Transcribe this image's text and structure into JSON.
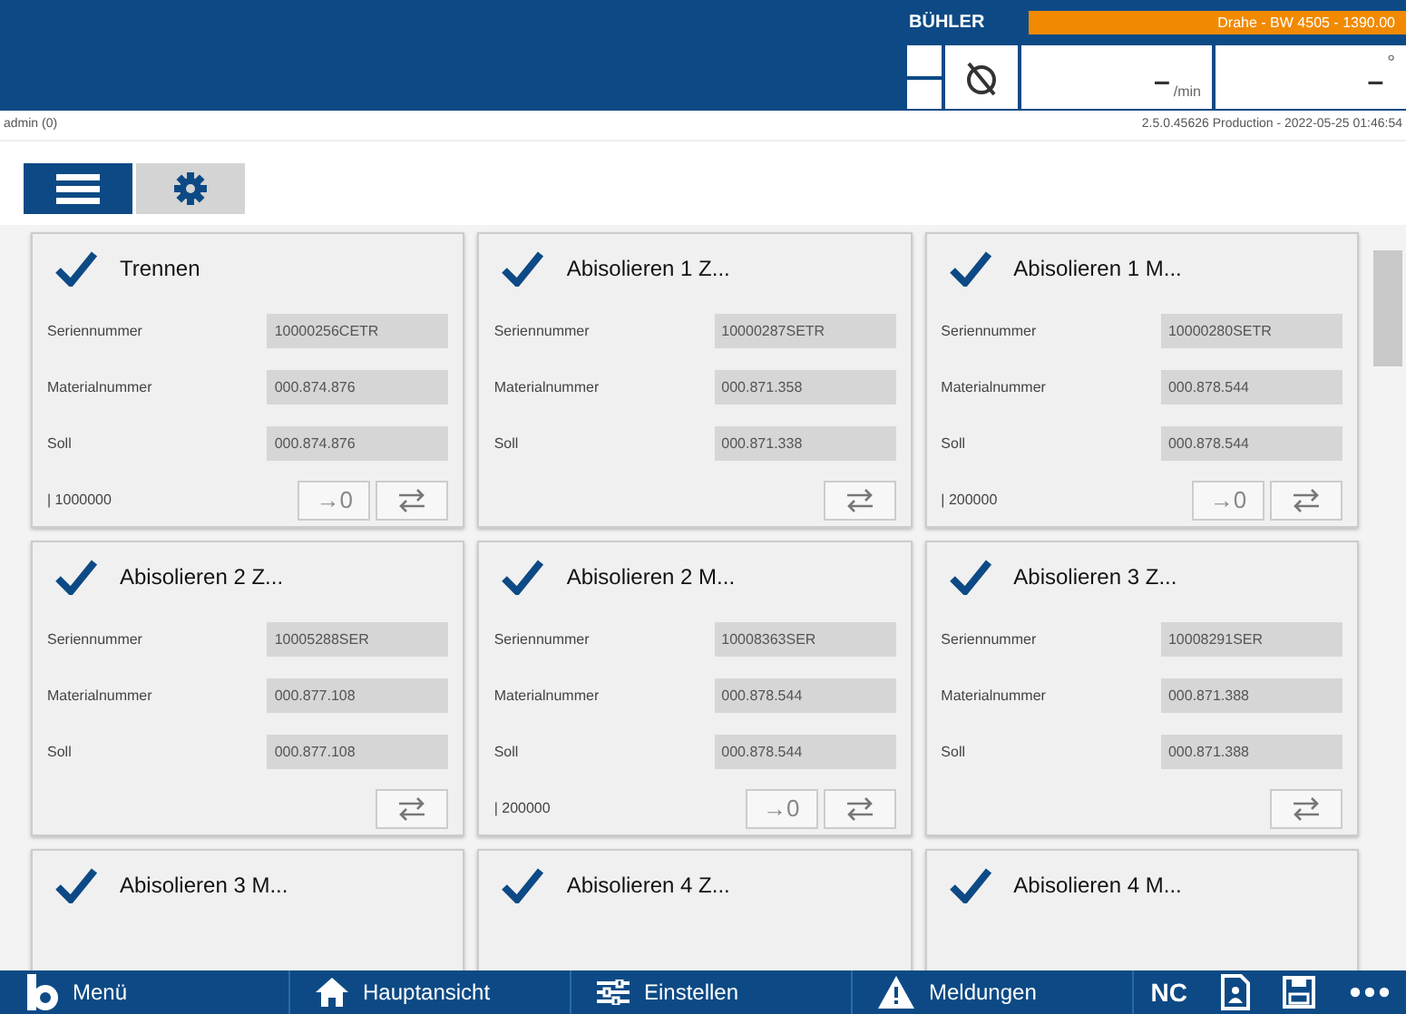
{
  "header": {
    "logo": "BÜHLER",
    "banner": "Drahe - BW 4505 - 1390.00",
    "speed": {
      "value": "–",
      "unit": "/min"
    },
    "angle": {
      "value": "–",
      "unit": "°"
    }
  },
  "user": "admin (0)",
  "version": "2.5.0.45626 Production - 2022-05-25 01:46:54",
  "tabs": [
    {
      "kind": "menu",
      "selected": true
    },
    {
      "kind": "settings",
      "selected": false
    }
  ],
  "cards": [
    {
      "title": "Trennen",
      "checked": true,
      "fields": [
        {
          "label": "Seriennummer",
          "value": "10000256CETR"
        },
        {
          "label": "Materialnummer",
          "value": "000.874.876"
        },
        {
          "label": "Soll",
          "value": "000.874.876"
        }
      ],
      "footer": {
        "counter": "| 1000000",
        "reset": "→0",
        "swap": true
      }
    },
    {
      "title": "Abisolieren 1 Z...",
      "checked": true,
      "fields": [
        {
          "label": "Seriennummer",
          "value": "10000287SETR"
        },
        {
          "label": "Materialnummer",
          "value": "000.871.358"
        },
        {
          "label": "Soll",
          "value": "000.871.338"
        }
      ],
      "footer": {
        "swap": true
      }
    },
    {
      "title": "Abisolieren 1 M...",
      "checked": true,
      "fields": [
        {
          "label": "Seriennummer",
          "value": "10000280SETR"
        },
        {
          "label": "Materialnummer",
          "value": "000.878.544"
        },
        {
          "label": "Soll",
          "value": "000.878.544"
        }
      ],
      "footer": {
        "counter": "| 200000",
        "reset": "→0",
        "swap": true
      }
    },
    {
      "title": "Abisolieren 2 Z...",
      "checked": true,
      "fields": [
        {
          "label": "Seriennummer",
          "value": "10005288SER"
        },
        {
          "label": "Materialnummer",
          "value": "000.877.108"
        },
        {
          "label": "Soll",
          "value": "000.877.108"
        }
      ],
      "footer": {
        "swap": true
      }
    },
    {
      "title": "Abisolieren 2 M...",
      "checked": true,
      "fields": [
        {
          "label": "Seriennummer",
          "value": "10008363SER"
        },
        {
          "label": "Materialnummer",
          "value": "000.878.544"
        },
        {
          "label": "Soll",
          "value": "000.878.544"
        }
      ],
      "footer": {
        "counter": "| 200000",
        "reset": "→0",
        "swap": true
      }
    },
    {
      "title": "Abisolieren 3 Z...",
      "checked": true,
      "fields": [
        {
          "label": "Seriennummer",
          "value": "10008291SER"
        },
        {
          "label": "Materialnummer",
          "value": "000.871.388"
        },
        {
          "label": "Soll",
          "value": "000.871.388"
        }
      ],
      "footer": {
        "swap": true
      }
    },
    {
      "title": "Abisolieren 3 M...",
      "checked": true
    },
    {
      "title": "Abisolieren 4 Z...",
      "checked": true
    },
    {
      "title": "Abisolieren 4 M...",
      "checked": true
    }
  ],
  "nav": [
    {
      "kind": "logo",
      "label": "Menü"
    },
    {
      "kind": "home",
      "label": "Hauptansicht"
    },
    {
      "kind": "sliders",
      "label": "Einstellen"
    },
    {
      "kind": "warning",
      "label": "Meldungen"
    }
  ],
  "tools": [
    {
      "kind": "text",
      "label": "NC"
    },
    {
      "kind": "document"
    },
    {
      "kind": "save"
    },
    {
      "kind": "more"
    }
  ]
}
